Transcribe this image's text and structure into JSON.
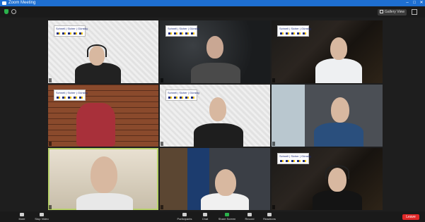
{
  "window": {
    "title": "Zoom Meeting",
    "minimize": "–",
    "maximize": "□",
    "close": "✕"
  },
  "topbar": {
    "view_label": "Gallery View"
  },
  "tiles": [
    {
      "name": "",
      "banner": "Schnell | Sicher | Günstig",
      "bg": "white",
      "headset": true
    },
    {
      "name": "",
      "banner": "Schnell | Sicher | Günstig",
      "bg": "dark",
      "headset": false
    },
    {
      "name": "",
      "banner": "Schnell | Sicher | Günstig",
      "bg": "marble",
      "headset": false
    },
    {
      "name": "",
      "banner": "Schnell | Sicher | Günstig",
      "bg": "brick",
      "headset": false
    },
    {
      "name": "",
      "banner": "Schnell | Sicher | Günstig",
      "bg": "white",
      "headset": false
    },
    {
      "name": "",
      "banner": "",
      "bg": "room",
      "headset": false
    },
    {
      "name": "",
      "banner": "",
      "bg": "office",
      "headset": false,
      "active_speaker": true
    },
    {
      "name": "",
      "banner": "",
      "bg": "shelf",
      "headset": false
    },
    {
      "name": "",
      "banner": "Schnell | Sicher | Günstig",
      "bg": "marble",
      "headset": true
    }
  ],
  "toolbar": {
    "items": [
      {
        "label": "Mute",
        "icon": "microphone-icon"
      },
      {
        "label": "Stop Video",
        "icon": "video-camera-icon"
      },
      {
        "label": "Participants",
        "icon": "participants-icon",
        "count": "9"
      },
      {
        "label": "Chat",
        "icon": "chat-icon"
      },
      {
        "label": "Share Screen",
        "icon": "share-screen-icon"
      },
      {
        "label": "Record",
        "icon": "record-icon"
      },
      {
        "label": "Reactions",
        "icon": "reactions-icon"
      }
    ],
    "end_label": "Leave"
  },
  "colors": {
    "accent": "#1e6fd1",
    "share_green": "#2bb24c",
    "speaker_border": "#b9d36b",
    "leave_red": "#e02828"
  }
}
